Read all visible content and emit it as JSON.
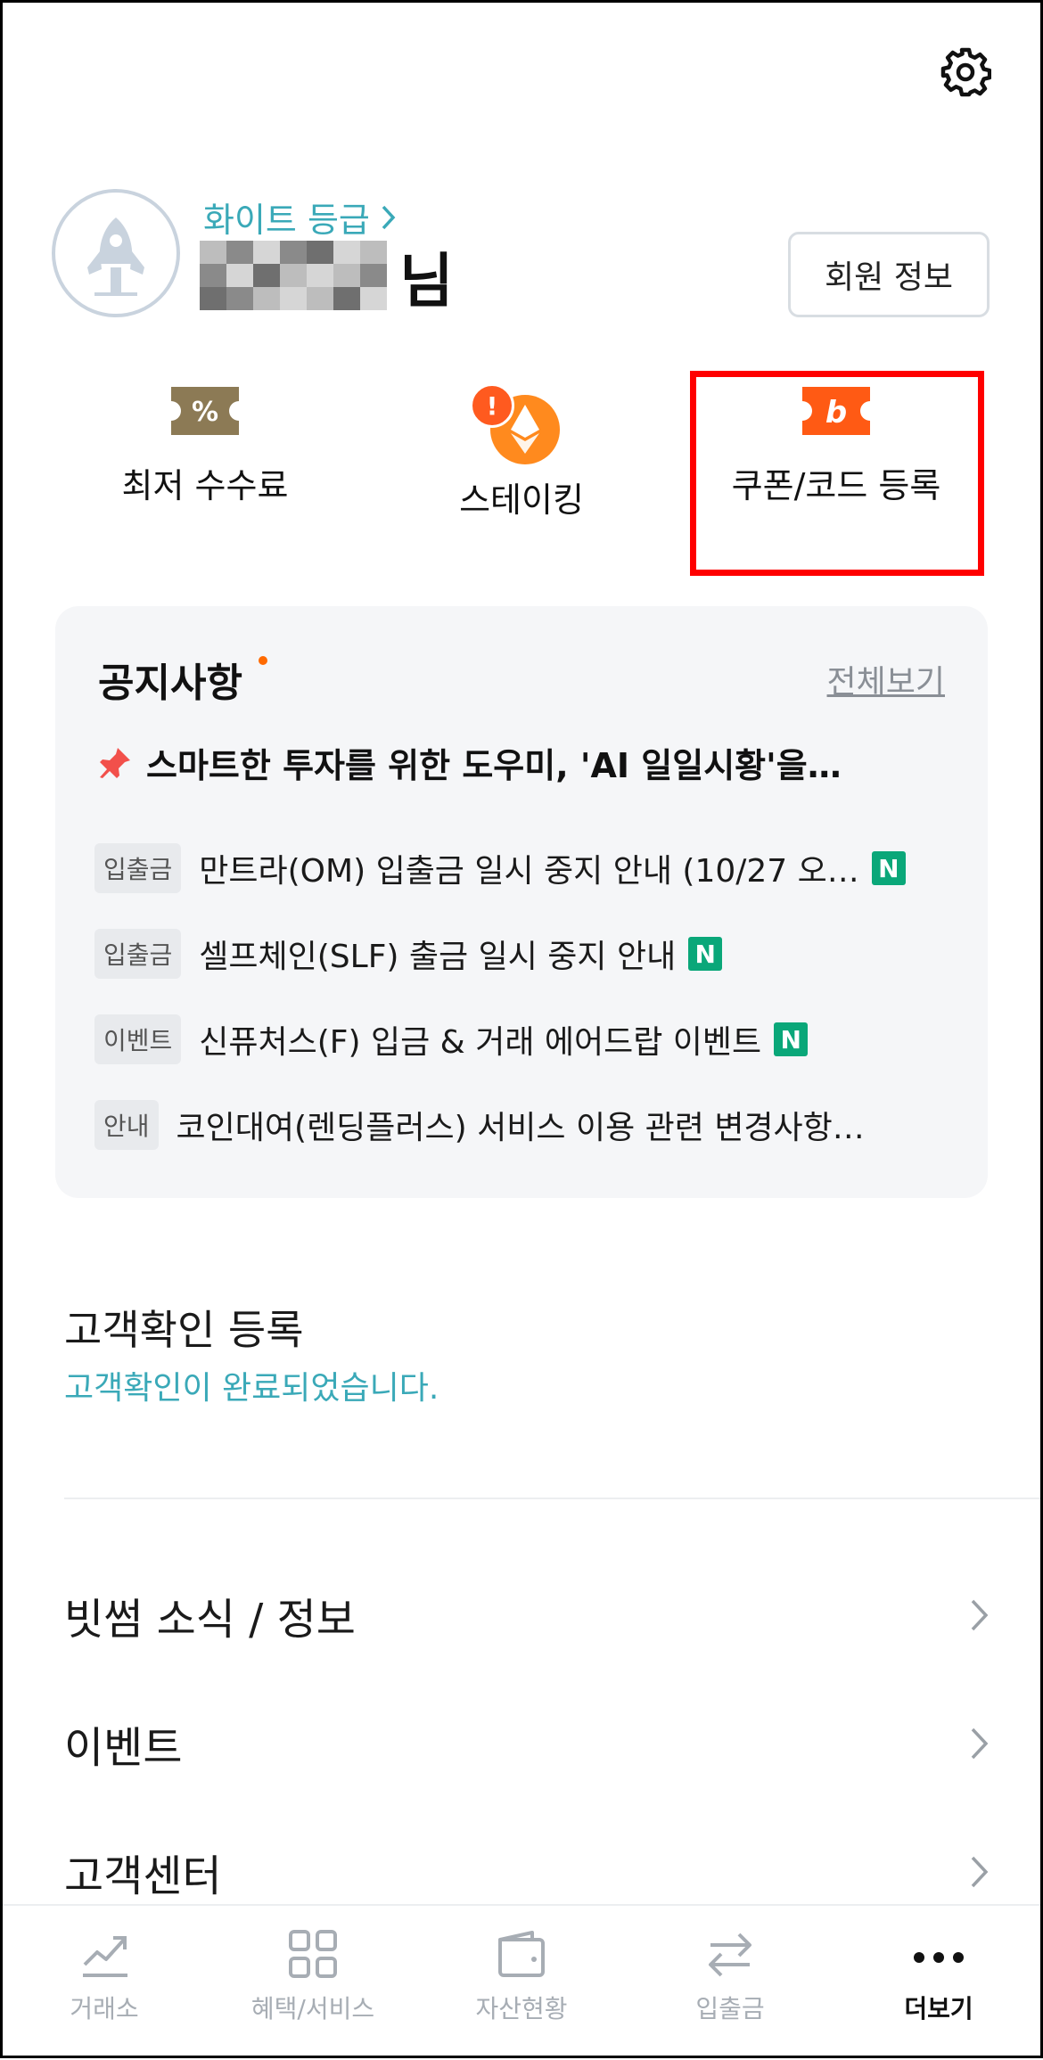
{
  "profile": {
    "grade": "화이트 등급",
    "name_suffix": "님",
    "member_button": "회원 정보"
  },
  "quick_actions": [
    {
      "label": "최저 수수료",
      "icon": "percent-ticket-icon"
    },
    {
      "label": "스테이킹",
      "icon": "ethereum-icon",
      "alert": "!"
    },
    {
      "label": "쿠폰/코드 등록",
      "icon": "coupon-icon"
    }
  ],
  "notice": {
    "title": "공지사항",
    "view_all": "전체보기",
    "pinned": "스마트한 투자를 위한 도우미, 'AI 일일시황'을…",
    "items": [
      {
        "tag": "입출금",
        "text": "만트라(OM) 입출금 일시 중지 안내 (10/27 오…",
        "new": "N"
      },
      {
        "tag": "입출금",
        "text": "셀프체인(SLF) 출금 일시 중지 안내",
        "new": "N"
      },
      {
        "tag": "이벤트",
        "text": "신퓨처스(F) 입금 & 거래 에어드랍 이벤트",
        "new": "N"
      },
      {
        "tag": "안내",
        "text": "코인대여(렌딩플러스) 서비스 이용 관련 변경사항…"
      }
    ]
  },
  "kyc": {
    "title": "고객확인 등록",
    "status": "고객확인이 완료되었습니다."
  },
  "menu": [
    {
      "label": "빗썸 소식 / 정보"
    },
    {
      "label": "이벤트"
    },
    {
      "label": "고객센터"
    }
  ],
  "tabs": [
    {
      "label": "거래소",
      "icon": "chart-trend-icon"
    },
    {
      "label": "혜택/서비스",
      "icon": "grid-icon"
    },
    {
      "label": "자산현황",
      "icon": "wallet-icon"
    },
    {
      "label": "입출금",
      "icon": "transfer-arrows-icon"
    },
    {
      "label": "더보기",
      "icon": "more-dots-icon",
      "active": true
    }
  ],
  "colors": {
    "accent_teal": "#3aa9b8",
    "brand_orange": "#ff6a00",
    "new_badge": "#0aa779",
    "highlight": "#ff0000"
  }
}
